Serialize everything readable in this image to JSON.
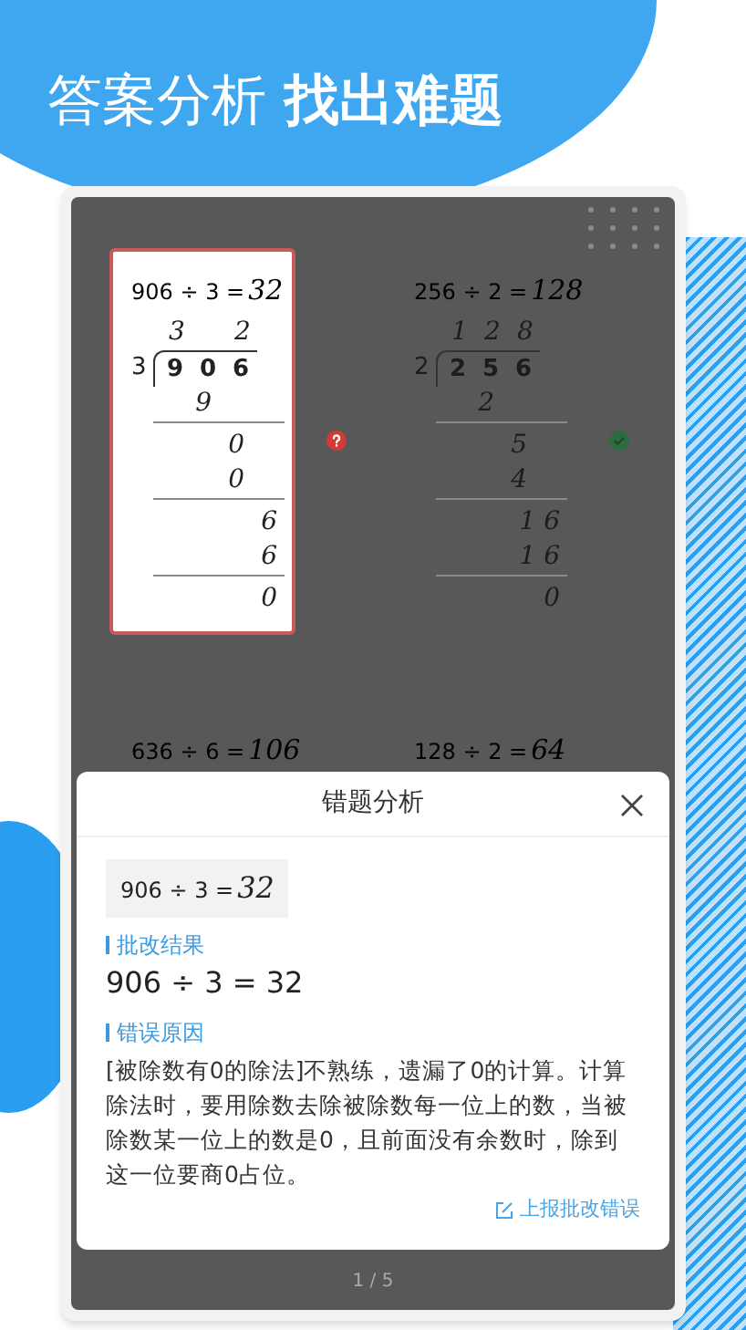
{
  "headline": {
    "part_1": "答案分析",
    "part_2": "找出难题"
  },
  "problems": [
    {
      "equation": "906 ÷ 3 =",
      "answer": "32",
      "selected": true,
      "correct": false,
      "divisor": "3",
      "dividend": [
        "9",
        "0",
        "6"
      ],
      "quotient": [
        "3",
        "2"
      ],
      "steps": [
        {
          "text": "9",
          "kind": "product"
        },
        {
          "text": "0",
          "kind": "remainder"
        },
        {
          "text": "0",
          "kind": "product"
        },
        {
          "text": "6",
          "kind": "remainder"
        },
        {
          "text": "6",
          "kind": "product"
        },
        {
          "text": "0",
          "kind": "remainder"
        }
      ]
    },
    {
      "equation": "256 ÷ 2 =",
      "answer": "128",
      "selected": false,
      "correct": true,
      "divisor": "2",
      "dividend": [
        "2",
        "5",
        "6"
      ],
      "quotient": [
        "1",
        "2",
        "8"
      ],
      "steps": [
        {
          "text": "2",
          "kind": "product"
        },
        {
          "text": "5",
          "kind": "remainder"
        },
        {
          "text": "4",
          "kind": "product"
        },
        {
          "text": "1 6",
          "kind": "remainder"
        },
        {
          "text": "1 6",
          "kind": "product"
        },
        {
          "text": "0",
          "kind": "remainder"
        }
      ]
    },
    {
      "equation": "636 ÷ 6 =",
      "answer": "106",
      "selected": false
    },
    {
      "equation": "128 ÷ 2 =",
      "answer": "64",
      "selected": false
    }
  ],
  "dialog": {
    "title": "错题分析",
    "question": {
      "equation": "906 ÷ 3 =",
      "answer": "32"
    },
    "sections": [
      {
        "heading": "批改结果",
        "body": "906 ÷ 3 = 32",
        "kind": "result"
      },
      {
        "heading": "错误原因",
        "body": "[被除数有0的除法]不熟练，遗漏了0的计算。计算除法时，要用除数去除被除数每一位上的数，当被除数某一位上的数是0，且前面没有余数时，除到这一位要商0占位。",
        "kind": "reason"
      }
    ],
    "report_link": "上报批改错误"
  },
  "pager": "1 / 5"
}
